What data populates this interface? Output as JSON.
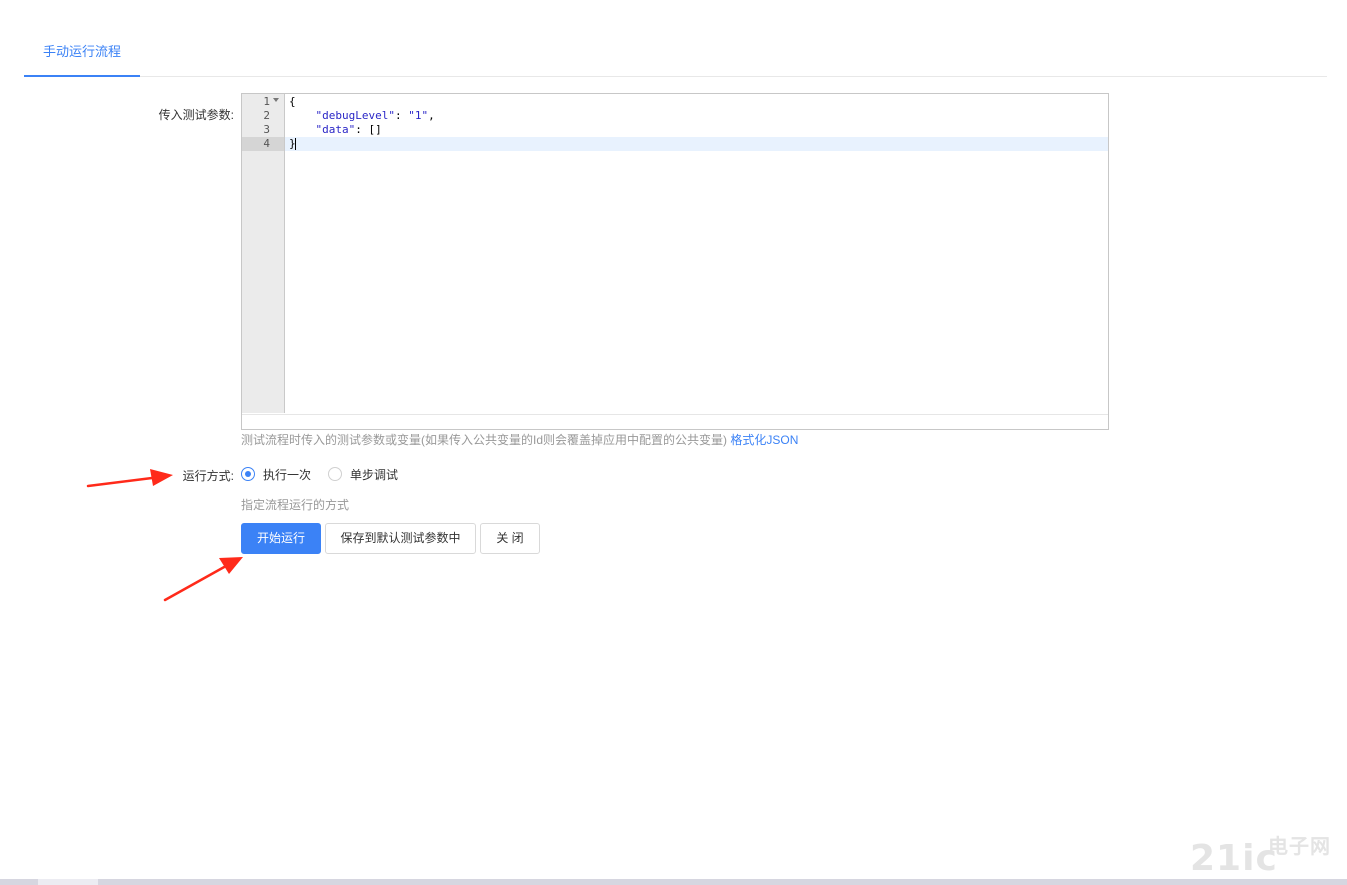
{
  "tabs": [
    {
      "label": "手动运行流程",
      "active": true
    }
  ],
  "form": {
    "params_label": "传入测试参数:",
    "editor": {
      "line_numbers": [
        "1",
        "2",
        "3",
        "4"
      ],
      "lines": [
        "{",
        "    \"debugLevel\": \"1\",",
        "    \"data\": []",
        "}"
      ],
      "line_parts": {
        "l1": "{",
        "l2_indent": "    ",
        "l2_key": "\"debugLevel\"",
        "l2_sep": ": ",
        "l2_val": "\"1\"",
        "l2_end": ",",
        "l3_indent": "    ",
        "l3_key": "\"data\"",
        "l3_rest": ": []",
        "l4": "}"
      }
    },
    "params_hint": "测试流程时传入的测试参数或变量(如果传入公共变量的Id则会覆盖掉应用中配置的公共变量)",
    "format_link": "格式化JSON",
    "mode_label": "运行方式:",
    "mode_options": [
      {
        "label": "执行一次",
        "checked": true
      },
      {
        "label": "单步调试",
        "checked": false
      }
    ],
    "mode_hint": "指定流程运行的方式",
    "buttons": {
      "start": "开始运行",
      "save": "保存到默认测试参数中",
      "close": "关 闭"
    }
  },
  "watermark": {
    "main": "21ic",
    "sub": "电子网"
  },
  "colors": {
    "primary": "#3b82f6",
    "annotation_arrow": "#ff2a1a",
    "hint_text": "#999999",
    "json_string": "#2a26c7"
  },
  "icons": [
    "fold-arrow-icon",
    "annotation-arrow-icon"
  ]
}
